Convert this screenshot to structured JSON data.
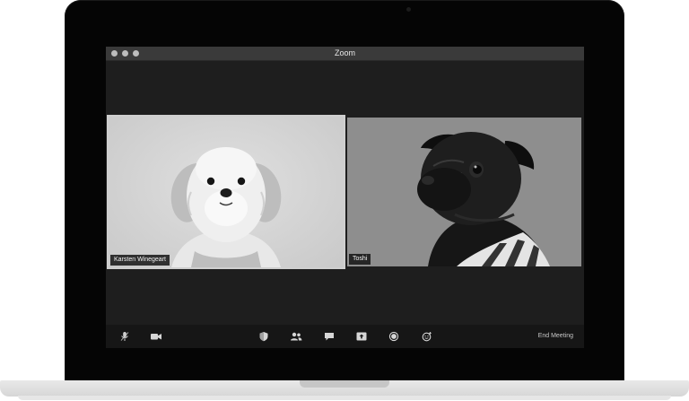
{
  "window": {
    "title": "Zoom"
  },
  "participants": [
    {
      "name": "Karsten Winegeart"
    },
    {
      "name": "Toshi"
    }
  ],
  "toolbar": {
    "icons": [
      "microphone-icon",
      "video-camera-icon",
      "security-shield-icon",
      "participants-icon",
      "chat-icon",
      "share-screen-icon",
      "record-icon",
      "reactions-icon"
    ],
    "end_meeting_label": "End Meeting"
  },
  "colors": {
    "window_bg": "#1e1e1e",
    "titlebar_bg": "#3a3a3a",
    "toolbar_bg": "#161616",
    "bezel": "#050505"
  }
}
